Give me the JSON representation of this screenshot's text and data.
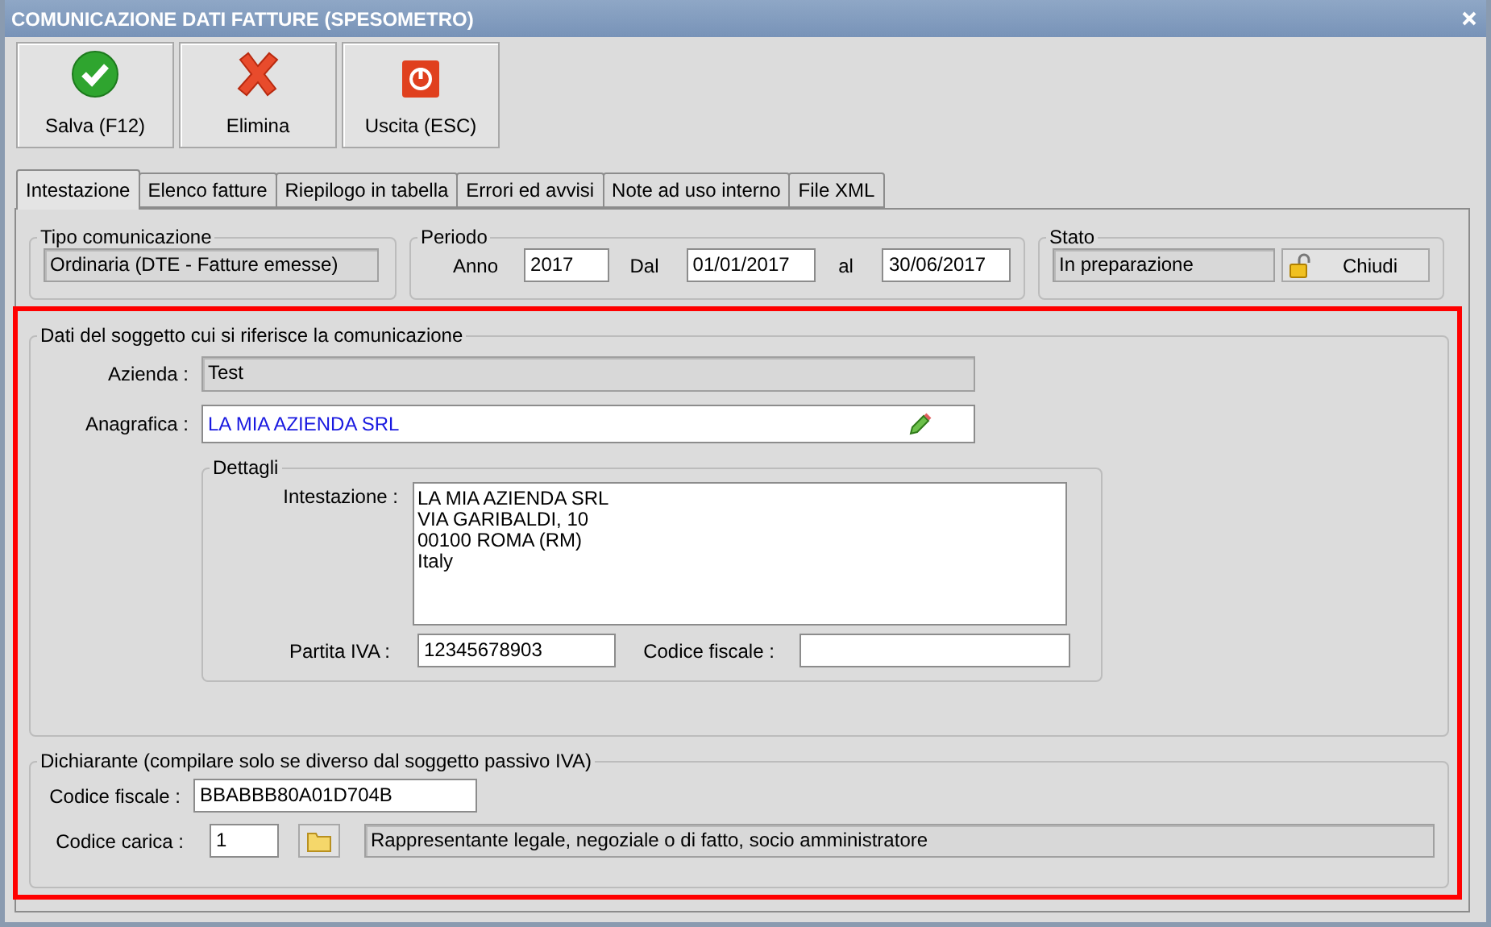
{
  "window": {
    "title": "COMUNICAZIONE DATI FATTURE (SPESOMETRO)"
  },
  "toolbar": [
    {
      "label": "Salva (F12)",
      "kind": "save"
    },
    {
      "label": "Elimina",
      "kind": "delete"
    },
    {
      "label": "Uscita (ESC)",
      "kind": "exit"
    }
  ],
  "tabs": [
    {
      "label": "Intestazione",
      "selected": true
    },
    {
      "label": "Elenco fatture",
      "selected": false
    },
    {
      "label": "Riepilogo in tabella",
      "selected": false
    },
    {
      "label": "Errori ed avvisi",
      "selected": false
    },
    {
      "label": "Note ad uso interno",
      "selected": false
    },
    {
      "label": "File XML",
      "selected": false
    }
  ],
  "tipo_comunicazione": {
    "legend": "Tipo comunicazione",
    "value": "Ordinaria (DTE - Fatture emesse)"
  },
  "periodo": {
    "legend": "Periodo",
    "anno_label": "Anno",
    "anno": "2017",
    "dal_label": "Dal",
    "dal": "01/01/2017",
    "al_label": "al",
    "al": "30/06/2017"
  },
  "stato": {
    "legend": "Stato",
    "value": "In preparazione",
    "button": "Chiudi"
  },
  "soggetto": {
    "legend": "Dati del soggetto cui si riferisce la comunicazione",
    "azienda_label": "Azienda :",
    "azienda": "Test",
    "anagrafica_label": "Anagrafica :",
    "anagrafica": "LA MIA AZIENDA SRL",
    "dettagli": {
      "legend": "Dettagli",
      "intestazione_label": "Intestazione :",
      "intestazione": [
        "LA MIA AZIENDA SRL",
        "VIA GARIBALDI, 10",
        "00100 ROMA (RM)",
        "Italy"
      ],
      "partita_iva_label": "Partita IVA :",
      "partita_iva": "12345678903",
      "codice_fiscale_label": "Codice fiscale :"
    }
  },
  "dichiarante": {
    "legend": "Dichiarante (compilare solo se diverso dal soggetto passivo IVA)",
    "codice_fiscale_label": "Codice fiscale :",
    "codice_fiscale": "BBABBB80A01D704B",
    "codice_carica_label": "Codice carica :",
    "codice_carica": "1",
    "carica_descrizione": "Rappresentante legale, negoziale o di fatto, socio amministratore"
  }
}
